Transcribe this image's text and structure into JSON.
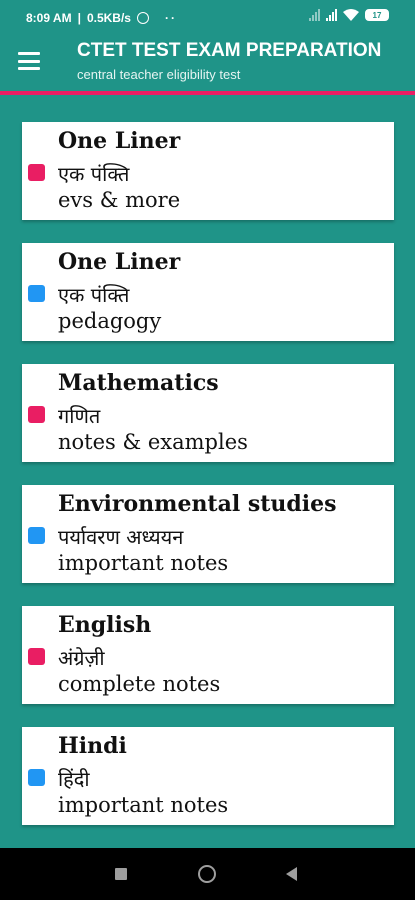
{
  "status_bar": {
    "time": "8:09 AM",
    "speed": "0.5KB/s",
    "dots": "··",
    "battery": "17"
  },
  "toolbar": {
    "title": "CTET TEST EXAM PREPARATION",
    "subtitle": "central teacher eligibility test"
  },
  "colors": {
    "primary": "#1f9488",
    "accent": "#e91e63",
    "blue": "#2196f3"
  },
  "cards": [
    {
      "title": "One Liner",
      "hindi": "एक पंक्ति",
      "desc": "evs & more",
      "color": "#e91e63"
    },
    {
      "title": "One Liner",
      "hindi": "एक पंक्ति",
      "desc": "pedagogy",
      "color": "#2196f3"
    },
    {
      "title": "Mathematics",
      "hindi": "गणित",
      "desc": "notes & examples",
      "color": "#e91e63"
    },
    {
      "title": "Environmental studies",
      "hindi": "पर्यावरण अध्ययन",
      "desc": "important notes",
      "color": "#2196f3"
    },
    {
      "title": "English",
      "hindi": "अंग्रेज़ी",
      "desc": "complete notes",
      "color": "#e91e63"
    },
    {
      "title": "Hindi",
      "hindi": "हिंदी",
      "desc": "important notes",
      "color": "#2196f3"
    }
  ]
}
